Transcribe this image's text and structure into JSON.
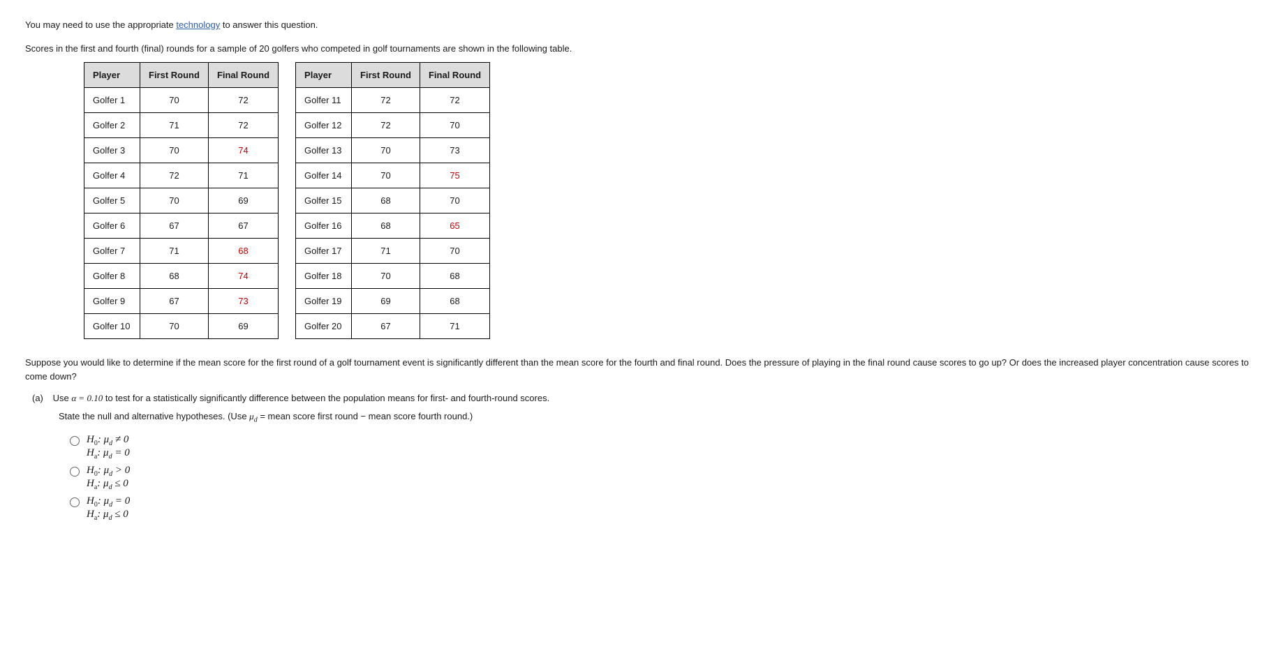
{
  "intro": {
    "pre": "You may need to use the appropriate ",
    "link": "technology",
    "post": " to answer this question."
  },
  "desc": "Scores in the first and fourth (final) rounds for a sample of 20 golfers who competed in golf tournaments are shown in the following table.",
  "headers": {
    "player": "Player",
    "first": "First Round",
    "final": "Final Round"
  },
  "table1": [
    {
      "player": "Golfer 1",
      "first": "70",
      "final": "72",
      "finalRed": false
    },
    {
      "player": "Golfer 2",
      "first": "71",
      "final": "72",
      "finalRed": false
    },
    {
      "player": "Golfer 3",
      "first": "70",
      "final": "74",
      "finalRed": true
    },
    {
      "player": "Golfer 4",
      "first": "72",
      "final": "71",
      "finalRed": false
    },
    {
      "player": "Golfer 5",
      "first": "70",
      "final": "69",
      "finalRed": false
    },
    {
      "player": "Golfer 6",
      "first": "67",
      "final": "67",
      "finalRed": false
    },
    {
      "player": "Golfer 7",
      "first": "71",
      "final": "68",
      "finalRed": true
    },
    {
      "player": "Golfer 8",
      "first": "68",
      "final": "74",
      "finalRed": true
    },
    {
      "player": "Golfer 9",
      "first": "67",
      "final": "73",
      "finalRed": true
    },
    {
      "player": "Golfer 10",
      "first": "70",
      "final": "69",
      "finalRed": false
    }
  ],
  "table2": [
    {
      "player": "Golfer 11",
      "first": "72",
      "final": "72",
      "finalRed": false
    },
    {
      "player": "Golfer 12",
      "first": "72",
      "final": "70",
      "finalRed": false
    },
    {
      "player": "Golfer 13",
      "first": "70",
      "final": "73",
      "finalRed": false
    },
    {
      "player": "Golfer 14",
      "first": "70",
      "final": "75",
      "finalRed": true
    },
    {
      "player": "Golfer 15",
      "first": "68",
      "final": "70",
      "finalRed": false
    },
    {
      "player": "Golfer 16",
      "first": "68",
      "final": "65",
      "finalRed": true
    },
    {
      "player": "Golfer 17",
      "first": "71",
      "final": "70",
      "finalRed": false
    },
    {
      "player": "Golfer 18",
      "first": "70",
      "final": "68",
      "finalRed": false
    },
    {
      "player": "Golfer 19",
      "first": "69",
      "final": "68",
      "finalRed": false
    },
    {
      "player": "Golfer 20",
      "first": "67",
      "final": "71",
      "finalRed": false
    }
  ],
  "question": "Suppose you would like to determine if the mean score for the first round of a golf tournament event is significantly different than the mean score for the fourth and final round. Does the pressure of playing in the final round cause scores to go up? Or does the increased player concentration cause scores to come down?",
  "partA": {
    "label": "(a)",
    "text_pre": "Use ",
    "alpha_eq": "α = 0.10",
    "text_post": " to test for a statistically significantly difference between the population means for first- and fourth-round scores."
  },
  "subQ": {
    "pre": "State the null and alternative hypotheses. (Use ",
    "mu": "μ",
    "mu_sub": "d",
    "post": " = mean score first round − mean score fourth round.)"
  },
  "options": [
    {
      "h0_op": "≠",
      "h0_val": "0",
      "ha_op": "=",
      "ha_val": "0"
    },
    {
      "h0_op": ">",
      "h0_val": "0",
      "ha_op": "≤",
      "ha_val": "0"
    },
    {
      "h0_op": "=",
      "h0_val": "0",
      "ha_op": "≤",
      "ha_val": "0"
    }
  ],
  "sym": {
    "H": "H",
    "zero": "0",
    "a": "a",
    "mu": "μ",
    "d": "d",
    "colon": ": "
  }
}
